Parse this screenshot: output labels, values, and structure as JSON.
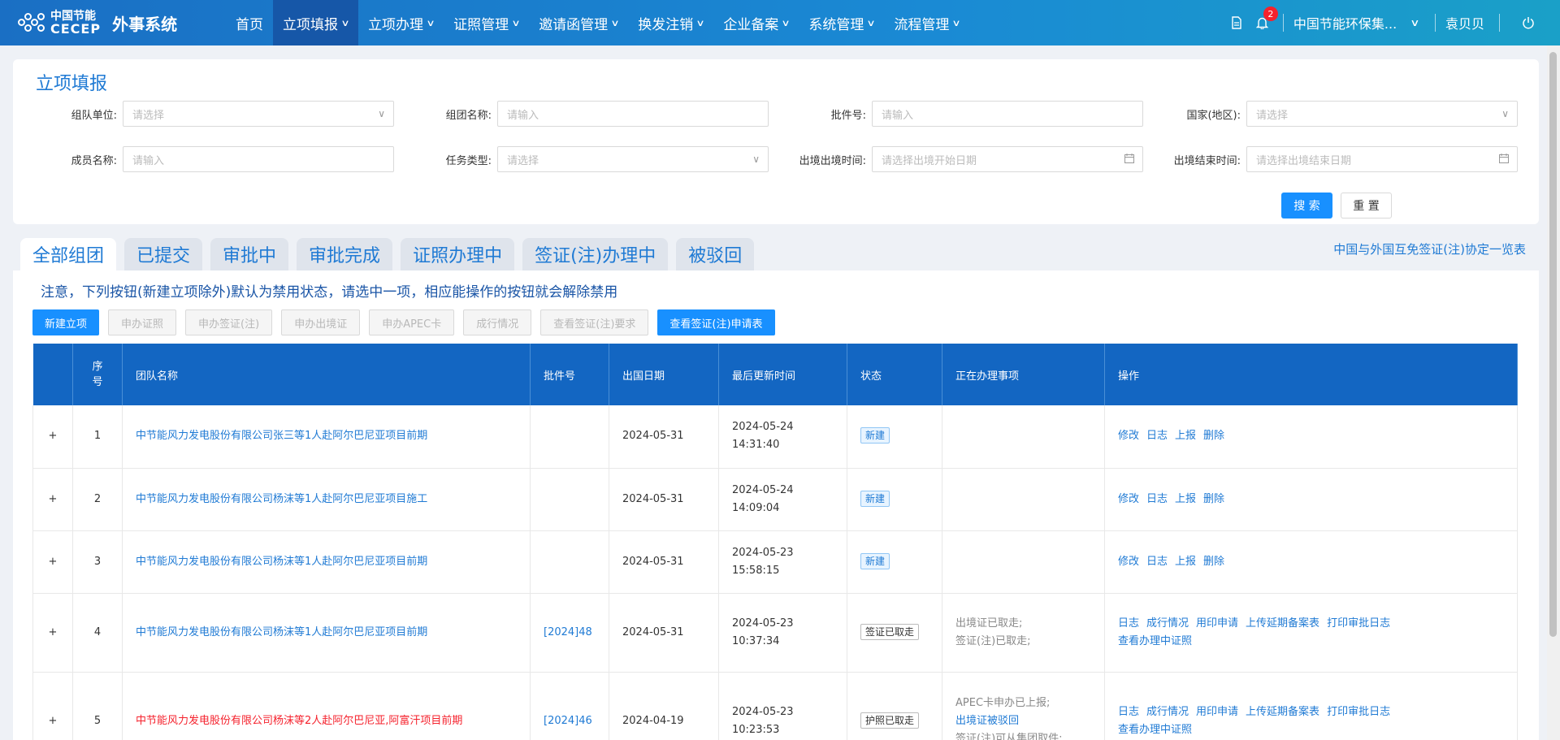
{
  "nav": {
    "logo_cn": "中国节能",
    "logo_en": "CECEP",
    "system_name": "外事系统",
    "menu": [
      {
        "label": "首页",
        "has_dropdown": false,
        "active": false
      },
      {
        "label": "立项填报",
        "has_dropdown": true,
        "active": true
      },
      {
        "label": "立项办理",
        "has_dropdown": true,
        "active": false
      },
      {
        "label": "证照管理",
        "has_dropdown": true,
        "active": false
      },
      {
        "label": "邀请函管理",
        "has_dropdown": true,
        "active": false
      },
      {
        "label": "换发注销",
        "has_dropdown": true,
        "active": false
      },
      {
        "label": "企业备案",
        "has_dropdown": true,
        "active": false
      },
      {
        "label": "系统管理",
        "has_dropdown": true,
        "active": false
      },
      {
        "label": "流程管理",
        "has_dropdown": true,
        "active": false
      }
    ],
    "notification_count": "2",
    "org_name": "中国节能环保集...",
    "user_name": "袁贝贝"
  },
  "search": {
    "title": "立项填报",
    "fields": {
      "team_unit": {
        "label": "组队单位:",
        "placeholder": "请选择"
      },
      "team_name": {
        "label": "组团名称:",
        "placeholder": "请输入"
      },
      "approval_no": {
        "label": "批件号:",
        "placeholder": "请输入"
      },
      "country": {
        "label": "国家(地区):",
        "placeholder": "请选择"
      },
      "member_name": {
        "label": "成员名称:",
        "placeholder": "请输入"
      },
      "task_type": {
        "label": "任务类型:",
        "placeholder": "请选择"
      },
      "depart_time": {
        "label": "出境出境时间:",
        "placeholder": "请选择出境开始日期"
      },
      "end_time": {
        "label": "出境结束时间:",
        "placeholder": "请选择出境结束日期"
      }
    },
    "search_label": "搜 索",
    "reset_label": "重 置"
  },
  "tabs": [
    "全部组团",
    "已提交",
    "审批中",
    "审批完成",
    "证照办理中",
    "签证(注)办理中",
    "被驳回"
  ],
  "active_tab": 0,
  "agreement_link": "中国与外国互免签证(注)协定一览表",
  "notice": "注意，下列按钮(新建立项除外)默认为禁用状态，请选中一项，相应能操作的按钮就会解除禁用",
  "actions": [
    {
      "label": "新建立项",
      "enabled": true
    },
    {
      "label": "申办证照",
      "enabled": false
    },
    {
      "label": "申办签证(注)",
      "enabled": false
    },
    {
      "label": "申办出境证",
      "enabled": false
    },
    {
      "label": "申办APEC卡",
      "enabled": false
    },
    {
      "label": "成行情况",
      "enabled": false
    },
    {
      "label": "查看签证(注)要求",
      "enabled": false
    },
    {
      "label": "查看签证(注)申请表",
      "enabled": true
    }
  ],
  "table": {
    "headers": {
      "seq": "序号",
      "team": "团队名称",
      "approval": "批件号",
      "date": "出国日期",
      "updated": "最后更新时间",
      "status": "状态",
      "pending": "正在办理事项",
      "ops": "操作"
    },
    "rows": [
      {
        "seq": "1",
        "team": "中节能风力发电股份有限公司张三等1人赴阿尔巴尼亚项目前期",
        "team_red": false,
        "approval": "",
        "date": "2024-05-31",
        "updated_date": "2024-05-24",
        "updated_time": "14:31:40",
        "status": "新建",
        "status_style": "blue",
        "pending": [],
        "ops": [
          [
            "修改",
            "日志",
            "上报",
            "删除"
          ]
        ]
      },
      {
        "seq": "2",
        "team": "中节能风力发电股份有限公司杨沫等1人赴阿尔巴尼亚项目施工",
        "team_red": false,
        "approval": "",
        "date": "2024-05-31",
        "updated_date": "2024-05-24",
        "updated_time": "14:09:04",
        "status": "新建",
        "status_style": "blue",
        "pending": [],
        "ops": [
          [
            "修改",
            "日志",
            "上报",
            "删除"
          ]
        ]
      },
      {
        "seq": "3",
        "team": "中节能风力发电股份有限公司杨沫等1人赴阿尔巴尼亚项目前期",
        "team_red": false,
        "approval": "",
        "date": "2024-05-31",
        "updated_date": "2024-05-23",
        "updated_time": "15:58:15",
        "status": "新建",
        "status_style": "blue",
        "pending": [],
        "ops": [
          [
            "修改",
            "日志",
            "上报",
            "删除"
          ]
        ]
      },
      {
        "seq": "4",
        "team": "中节能风力发电股份有限公司杨沫等1人赴阿尔巴尼亚项目前期",
        "team_red": false,
        "approval": "[2024]48",
        "date": "2024-05-31",
        "updated_date": "2024-05-23",
        "updated_time": "10:37:34",
        "status": "签证已取走",
        "status_style": "gray",
        "pending": [
          {
            "text": "出境证已取走;",
            "blue": false
          },
          {
            "text": "签证(注)已取走;",
            "blue": false
          }
        ],
        "ops": [
          [
            "日志",
            "成行情况",
            "用印申请",
            "上传延期备案表",
            "打印审批日志"
          ],
          [
            "查看办理中证照"
          ]
        ]
      },
      {
        "seq": "5",
        "team": "中节能风力发电股份有限公司杨沫等2人赴阿尔巴尼亚,阿富汗项目前期",
        "team_red": true,
        "approval": "[2024]46",
        "date": "2024-04-19",
        "updated_date": "2024-05-23",
        "updated_time": "10:23:53",
        "status": "护照已取走",
        "status_style": "gray",
        "pending": [
          {
            "text": "APEC卡申办已上报;",
            "blue": false
          },
          {
            "text": "出境证被驳回",
            "blue": true
          },
          {
            "text": "签证(注)可从集团取件;",
            "blue": false
          }
        ],
        "ops": [
          [
            "日志",
            "成行情况",
            "用印申请",
            "上传延期备案表",
            "打印审批日志"
          ],
          [
            "查看办理中证照"
          ]
        ]
      }
    ]
  }
}
